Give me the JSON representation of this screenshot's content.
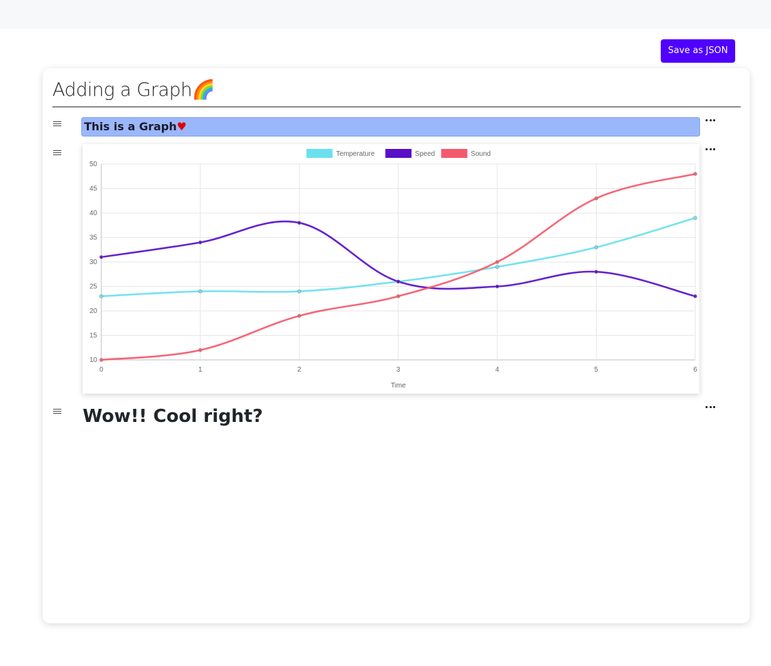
{
  "toolbar": {
    "save_label": "Save as JSON"
  },
  "document": {
    "title": "Adding a Graph",
    "title_emoji": "🌈",
    "blocks": [
      {
        "type": "heading",
        "text": "This is a Graph",
        "emoji": "♥"
      },
      {
        "type": "chart"
      },
      {
        "type": "heading",
        "text": "Wow!! Cool right?"
      }
    ]
  },
  "icons": {
    "drag": "drag-handle-icon",
    "more": "more-options-icon"
  },
  "colors": {
    "accent": "#4f00ff",
    "highlight": "#9bb7fb"
  },
  "chart_data": {
    "type": "line",
    "x": [
      0,
      1,
      2,
      3,
      4,
      5,
      6
    ],
    "xlabel": "Time",
    "ylabel": "",
    "ylim": [
      10,
      50
    ],
    "yticks": [
      10,
      15,
      20,
      25,
      30,
      35,
      40,
      45,
      50
    ],
    "grid": true,
    "legend_position": "top",
    "series": [
      {
        "name": "Temperature",
        "color": "#6ae0ee",
        "values": [
          23,
          24,
          24,
          26,
          29,
          33,
          39
        ]
      },
      {
        "name": "Speed",
        "color": "#5a0fc8",
        "values": [
          31,
          34,
          38,
          26,
          25,
          28,
          23
        ]
      },
      {
        "name": "Sound",
        "color": "#f45a6d",
        "values": [
          10,
          12,
          19,
          23,
          30,
          43,
          48
        ]
      }
    ]
  }
}
